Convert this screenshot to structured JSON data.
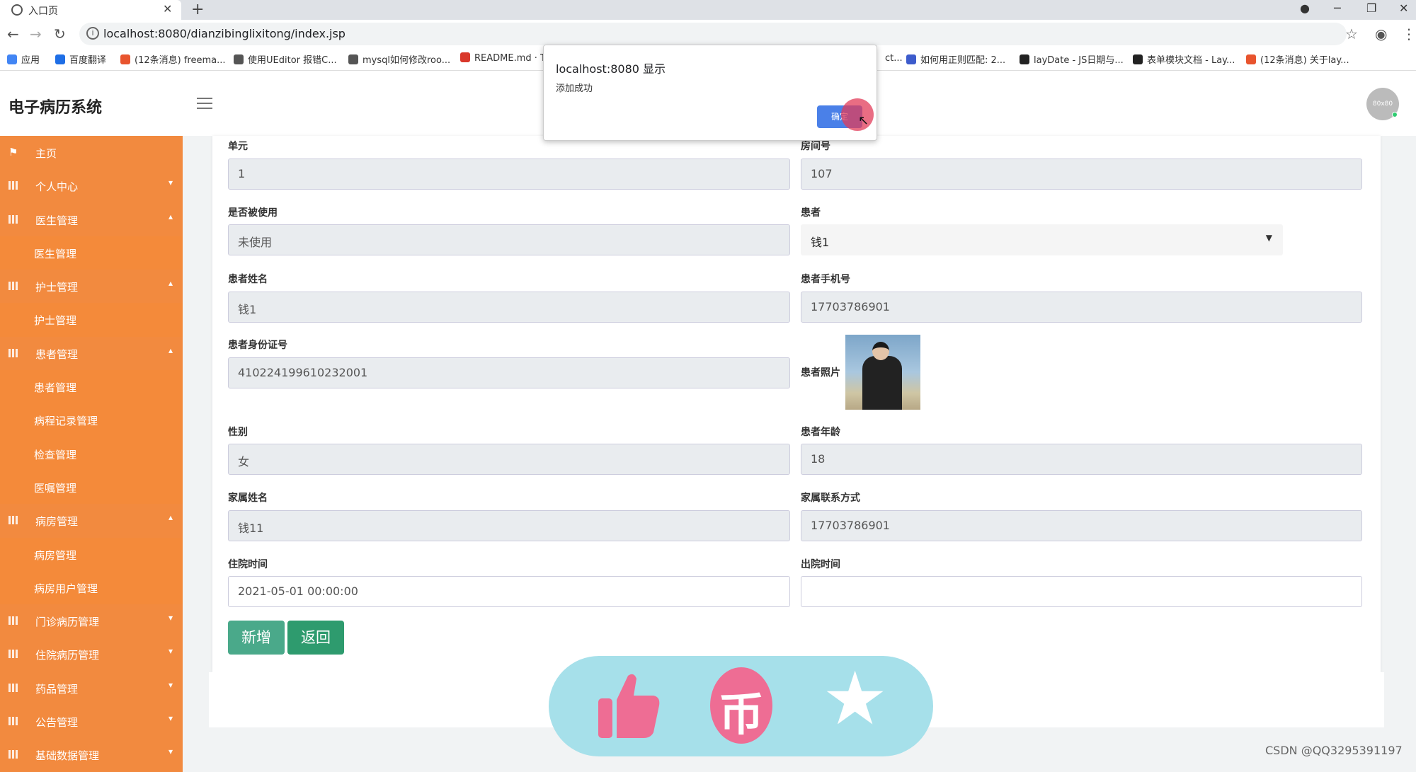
{
  "browser": {
    "tab_title": "入口页",
    "url": "localhost:8080/dianzibinglixitong/index.jsp",
    "bookmarks": [
      {
        "label": "应用",
        "color": "#4285f4"
      },
      {
        "label": "百度翻译",
        "color": "#1e6ee6"
      },
      {
        "label": "(12条消息) freema...",
        "color": "#e8542e"
      },
      {
        "label": "使用UEditor 报错C...",
        "color": "#555555"
      },
      {
        "label": "mysql如何修改roo...",
        "color": "#555555"
      },
      {
        "label": "README.md · T",
        "color": "#d9382b"
      },
      {
        "label": "ct...",
        "color": "#ffffff"
      },
      {
        "label": "如何用正则匹配: 2...",
        "color": "#3d5ccc"
      },
      {
        "label": "layDate - JS日期与...",
        "color": "#222222"
      },
      {
        "label": "表单模块文档 - Lay...",
        "color": "#222222"
      },
      {
        "label": "(12条消息) 关于lay...",
        "color": "#e8542e"
      }
    ]
  },
  "app": {
    "title": "电子病历系统",
    "avatar_text": "80x80"
  },
  "sidebar": {
    "items": [
      {
        "label": "主页",
        "type": "top",
        "icon": "flag-icon",
        "caret": ""
      },
      {
        "label": "个人中心",
        "type": "top",
        "icon": "grid-icon",
        "caret": "▾"
      },
      {
        "label": "医生管理",
        "type": "top",
        "icon": "grid-icon",
        "caret": "▴"
      },
      {
        "label": "医生管理",
        "type": "sub",
        "icon": "",
        "caret": ""
      },
      {
        "label": "护士管理",
        "type": "top",
        "icon": "grid-icon",
        "caret": "▴"
      },
      {
        "label": "护士管理",
        "type": "sub",
        "icon": "",
        "caret": ""
      },
      {
        "label": "患者管理",
        "type": "top",
        "icon": "grid-icon",
        "caret": "▴"
      },
      {
        "label": "患者管理",
        "type": "sub",
        "icon": "",
        "caret": ""
      },
      {
        "label": "病程记录管理",
        "type": "sub",
        "icon": "",
        "caret": ""
      },
      {
        "label": "检查管理",
        "type": "sub",
        "icon": "",
        "caret": ""
      },
      {
        "label": "医嘱管理",
        "type": "sub",
        "icon": "",
        "caret": ""
      },
      {
        "label": "病房管理",
        "type": "top",
        "icon": "grid-icon",
        "caret": "▴"
      },
      {
        "label": "病房管理",
        "type": "sub",
        "icon": "",
        "caret": ""
      },
      {
        "label": "病房用户管理",
        "type": "sub",
        "icon": "",
        "caret": ""
      },
      {
        "label": "门诊病历管理",
        "type": "top",
        "icon": "grid-icon",
        "caret": "▾"
      },
      {
        "label": "住院病历管理",
        "type": "top",
        "icon": "grid-icon",
        "caret": "▾"
      },
      {
        "label": "药品管理",
        "type": "top",
        "icon": "grid-icon",
        "caret": "▾"
      },
      {
        "label": "公告管理",
        "type": "top",
        "icon": "grid-icon",
        "caret": "▾"
      },
      {
        "label": "基础数据管理",
        "type": "top",
        "icon": "grid-icon",
        "caret": "▾"
      }
    ]
  },
  "form": {
    "unit": {
      "label": "单元",
      "value": "1"
    },
    "room": {
      "label": "房间号",
      "value": "107"
    },
    "used": {
      "label": "是否被使用",
      "value": "未使用"
    },
    "patient": {
      "label": "患者",
      "value": "钱1"
    },
    "patient_name": {
      "label": "患者姓名",
      "value": "钱1"
    },
    "patient_phone": {
      "label": "患者手机号",
      "value": "17703786901"
    },
    "patient_id": {
      "label": "患者身份证号",
      "value": "410224199610232001"
    },
    "patient_photo": {
      "label": "患者照片"
    },
    "gender": {
      "label": "性别",
      "value": "女"
    },
    "age": {
      "label": "患者年龄",
      "value": "18"
    },
    "family_name": {
      "label": "家属姓名",
      "value": "钱11"
    },
    "family_phone": {
      "label": "家属联系方式",
      "value": "17703786901"
    },
    "admit_time": {
      "label": "住院时间",
      "value": "2021-05-01 00:00:00"
    },
    "discharge_time": {
      "label": "出院时间",
      "value": ""
    },
    "add_button": "新增",
    "back_button": "返回"
  },
  "dialog": {
    "title": "localhost:8080 显示",
    "message": "添加成功",
    "ok": "确定"
  },
  "watermark": "CSDN @QQ3295391197",
  "colors": {
    "sidebar": "#f3893c",
    "primary_button": "#4aa98a",
    "dialog_ok": "#4a80e8"
  }
}
